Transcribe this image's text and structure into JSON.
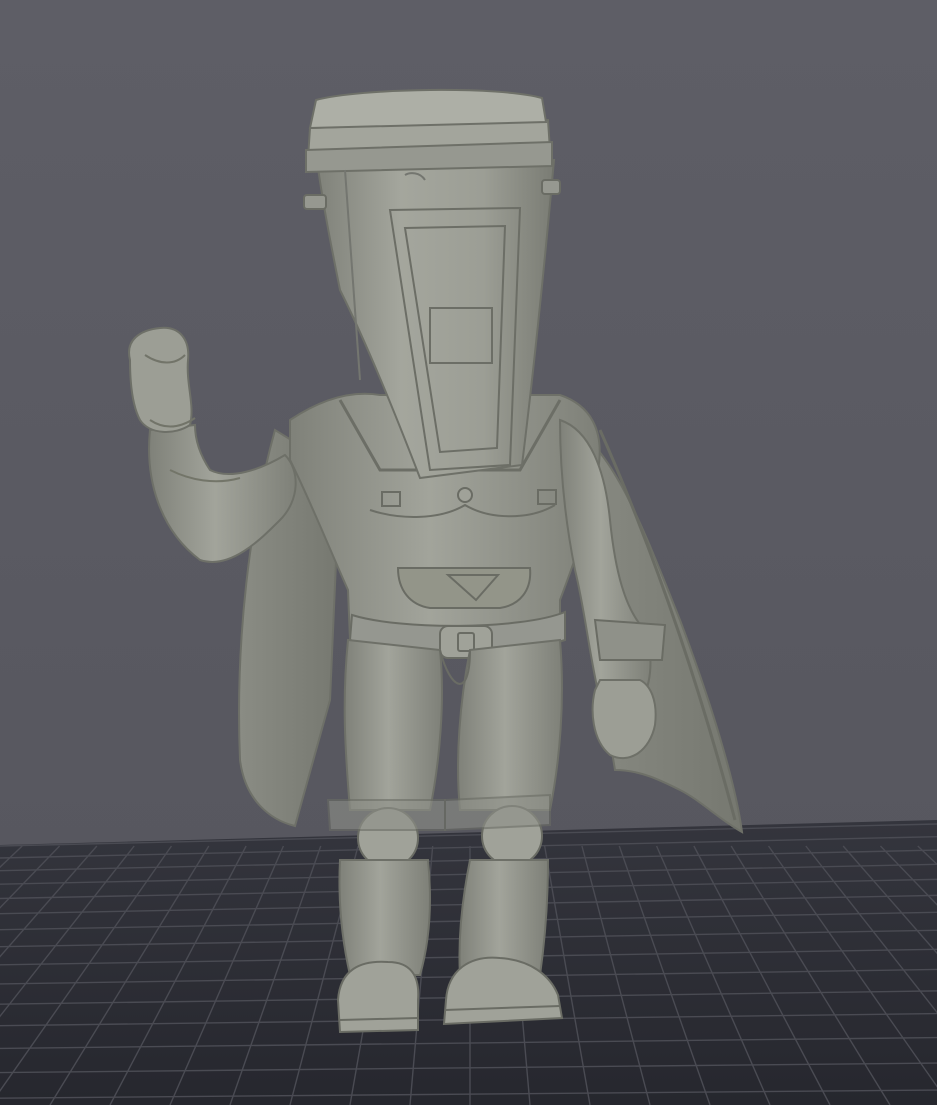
{
  "viewport": {
    "background_color": "#5b5b63",
    "grid_floor_color": "#2e2f37",
    "grid_line_color": "#4a4b53",
    "model_color": "#9a9c93",
    "model_shade_color": "#7c7e76",
    "model_highlight_color": "#b3b5ac"
  },
  "scene": {
    "objects": [
      {
        "name": "cup-head-figure",
        "material": "gray-clay"
      },
      {
        "name": "build-plate-grid"
      }
    ]
  }
}
